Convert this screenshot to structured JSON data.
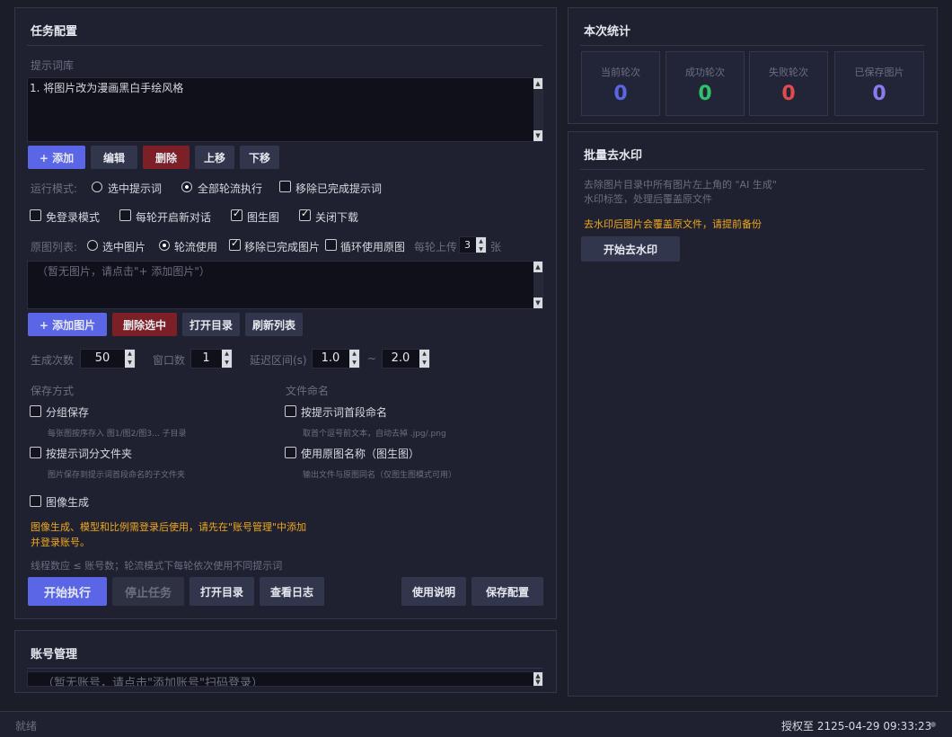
{
  "task": {
    "title": "任务配置",
    "prompt_lib_label": "提示词库",
    "prompt_items": [
      "1. 将图片改为漫画黑白手绘风格"
    ],
    "prompt_buttons": {
      "add": "+ 添加",
      "edit": "编辑",
      "delete": "删除",
      "up": "上移",
      "down": "下移"
    },
    "run_mode_label": "运行模式:",
    "run_mode_options": [
      "选中提示词",
      "全部轮流执行",
      "移除已完成提示词"
    ],
    "options": [
      "免登录模式",
      "每轮开启新对话",
      "图生图",
      "关闭下载"
    ],
    "source_label": "原图列表:",
    "source_options": [
      "选中图片",
      "轮流使用",
      "移除已完成图片",
      "循环使用原图"
    ],
    "per_round_label": "每轮上传",
    "per_round_value": "3",
    "per_round_unit": "张",
    "image_placeholder": "（暂无图片，请点击\"+ 添加图片\"）",
    "image_buttons": {
      "add": "+ 添加图片",
      "delete": "删除选中",
      "open": "打开目录",
      "refresh": "刷新列表"
    },
    "gen_count_label": "生成次数",
    "gen_count": "50",
    "window_label": "窗口数",
    "window_count": "1",
    "delay_label": "延迟区间(s)",
    "delay_min": "1.0",
    "delay_sep": "~",
    "delay_max": "2.0",
    "save_label": "保存方式",
    "save_group": "分组保存",
    "save_group_desc": "每张图按序存入 图1/图2/图3... 子目录",
    "save_folder": "按提示词分文件夹",
    "save_folder_desc": "图片保存到提示词首段命名的子文件夹",
    "naming_label": "文件命名",
    "naming_prompt": "按提示词首段命名",
    "naming_prompt_desc": "取首个逗号前文本，自动去掉 .jpg/.png",
    "naming_source": "使用原图名称（图生图）",
    "naming_source_desc": "输出文件与原图同名（仅图生图模式可用）",
    "image_gen": "图像生成",
    "image_gen_warn_1": "图像生成、模型和比例需登录后使用，请先在\"账号管理\"中添加",
    "image_gen_warn_2": "并登录账号。",
    "thread_hint": "线程数应 ≤ 账号数；轮流模式下每轮依次使用不同提示词",
    "actions": {
      "start": "开始执行",
      "stop": "停止任务",
      "open": "打开目录",
      "log": "查看日志",
      "help": "使用说明",
      "save": "保存配置"
    }
  },
  "account": {
    "title": "账号管理",
    "placeholder": "（暂无账号，请点击\"添加账号\"扫码登录）"
  },
  "stats": {
    "title": "本次统计",
    "items": [
      {
        "label": "当前轮次",
        "value": "0",
        "color": "#5b66e6"
      },
      {
        "label": "成功轮次",
        "value": "0",
        "color": "#2fc26b"
      },
      {
        "label": "失败轮次",
        "value": "0",
        "color": "#e24b4b"
      },
      {
        "label": "已保存图片",
        "value": "0",
        "color": "#8a7cf0"
      }
    ]
  },
  "watermark": {
    "title": "批量去水印",
    "desc_1": "去除图片目录中所有图片左上角的 \"AI 生成\"",
    "desc_2": "水印标签，处理后覆盖原文件",
    "warn": "去水印后图片会覆盖原文件，请提前备份",
    "button": "开始去水印"
  },
  "status": {
    "left": "就绪",
    "right": "授权至 2125-04-29 09:33:23"
  }
}
